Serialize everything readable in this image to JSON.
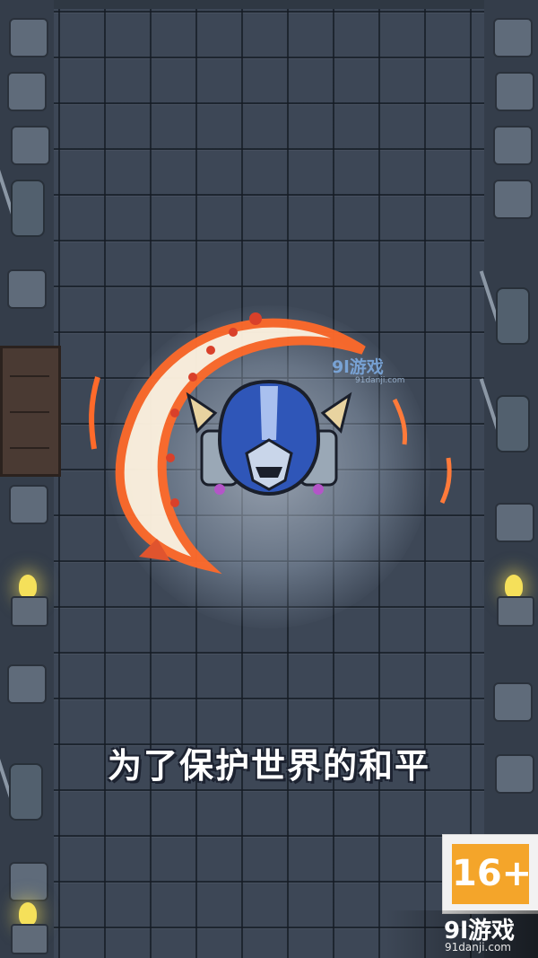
{
  "caption": "为了保护世界的和平",
  "rating": {
    "label": "16+",
    "color": "#f4a52a"
  },
  "watermark_center": {
    "main": "9l游戏",
    "sub": "91danji.com"
  },
  "watermark_corner": {
    "main": "9l游戏",
    "sub": "91danji.com"
  },
  "hero": {
    "icon": "blue-horned-knight",
    "attack": "crescent-slash"
  },
  "scene": {
    "icons": [
      "torch",
      "spear-statue",
      "wooden-door",
      "stone-wall"
    ]
  }
}
